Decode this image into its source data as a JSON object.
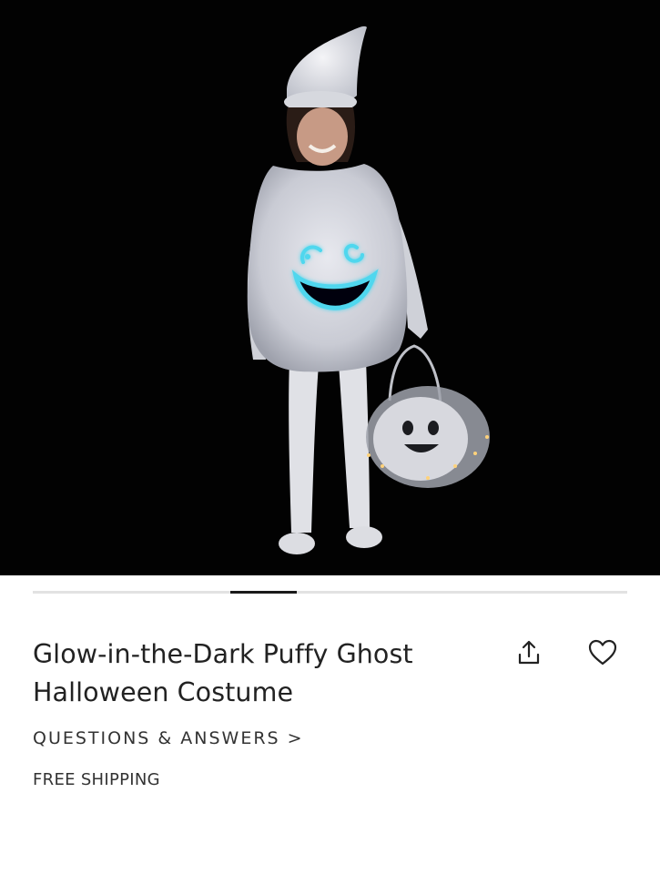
{
  "product": {
    "title": "Glow-in-the-Dark Puffy Ghost Halloween Costume",
    "image_alt": "Child wearing a white puffy ghost costume with a glowing smiley face, holding a ghost treat bucket"
  },
  "carousel": {
    "active_slide": 4,
    "slide_count": 9
  },
  "actions": {
    "share_icon": "share-icon",
    "wishlist_icon": "heart-icon"
  },
  "links": {
    "qa_label": "QUESTIONS & ANSWERS >"
  },
  "shipping": {
    "label": "FREE SHIPPING"
  },
  "colors": {
    "glow": "#4fd7ee",
    "background": "#020202",
    "text": "#222222"
  }
}
